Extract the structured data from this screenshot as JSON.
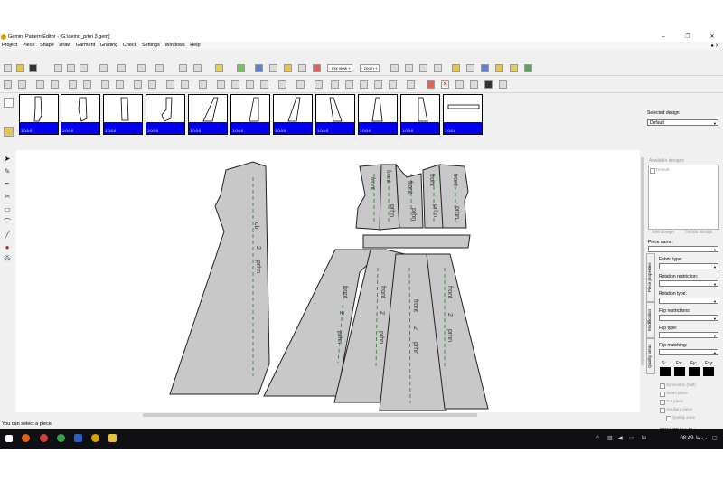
{
  "window": {
    "title": "Gemini Pattern Editor - [G:\\demo_prhn 3.gem]",
    "min": "–",
    "max": "❐",
    "close": "✕"
  },
  "menu": [
    "Project",
    "Piece",
    "Shape",
    "Draw",
    "Garment",
    "Grading",
    "Check",
    "Settings",
    "Windows",
    "Help"
  ],
  "toolbar": {
    "mix_view": "- mix view +",
    "zoom": "- zoom +"
  },
  "thumbnails": [
    "1:0:0:0",
    "1:0:0:0",
    "1:0:0:0",
    "1:0:0:0",
    "1:0:0:0",
    "1:0:0:0",
    "1:0:0:0",
    "1:0:0:0",
    "1:0:0:0",
    "1:0:0:0",
    "1:0:0:0"
  ],
  "selected_design": {
    "label": "Selected design",
    "value": "Default"
  },
  "available_designs": {
    "label": "Available designs",
    "item": "Default",
    "add_button": "Add design",
    "delete_button": "Delete design"
  },
  "properties": {
    "piece_name": "Piece name:",
    "fabric_type": "Fabric type:",
    "rotation_restriction": "Rotation restriction:",
    "rotation_type": "Rotation type:",
    "flip_restrictions": "Flip restrictions:",
    "flip_type": "Flip type:",
    "flip_matching": "Flip matching:",
    "swatch_labels": [
      "S:",
      "Fx:",
      "Fy:",
      "Fxy:"
    ],
    "checkboxes": [
      "Symmetric (half)",
      "Seam piece",
      "Cut piece",
      "Auxiliary piece",
      "Quality zone"
    ],
    "layer": "Layer CUT / PLT :"
  },
  "tabs": [
    "Piece properties",
    "Modification",
    "Quality areas"
  ],
  "pieces": {
    "back_label": "cb",
    "num": "2",
    "prhn": "prhn",
    "front": "front"
  },
  "status": "You can select a piece.",
  "taskbar": {
    "clock": "08:49 ب.ظ",
    "lang": "fa"
  },
  "colors": {
    "accent": "#0000ee",
    "piece_fill": "#c8c8c8",
    "taskbar": "#0f0f14"
  }
}
